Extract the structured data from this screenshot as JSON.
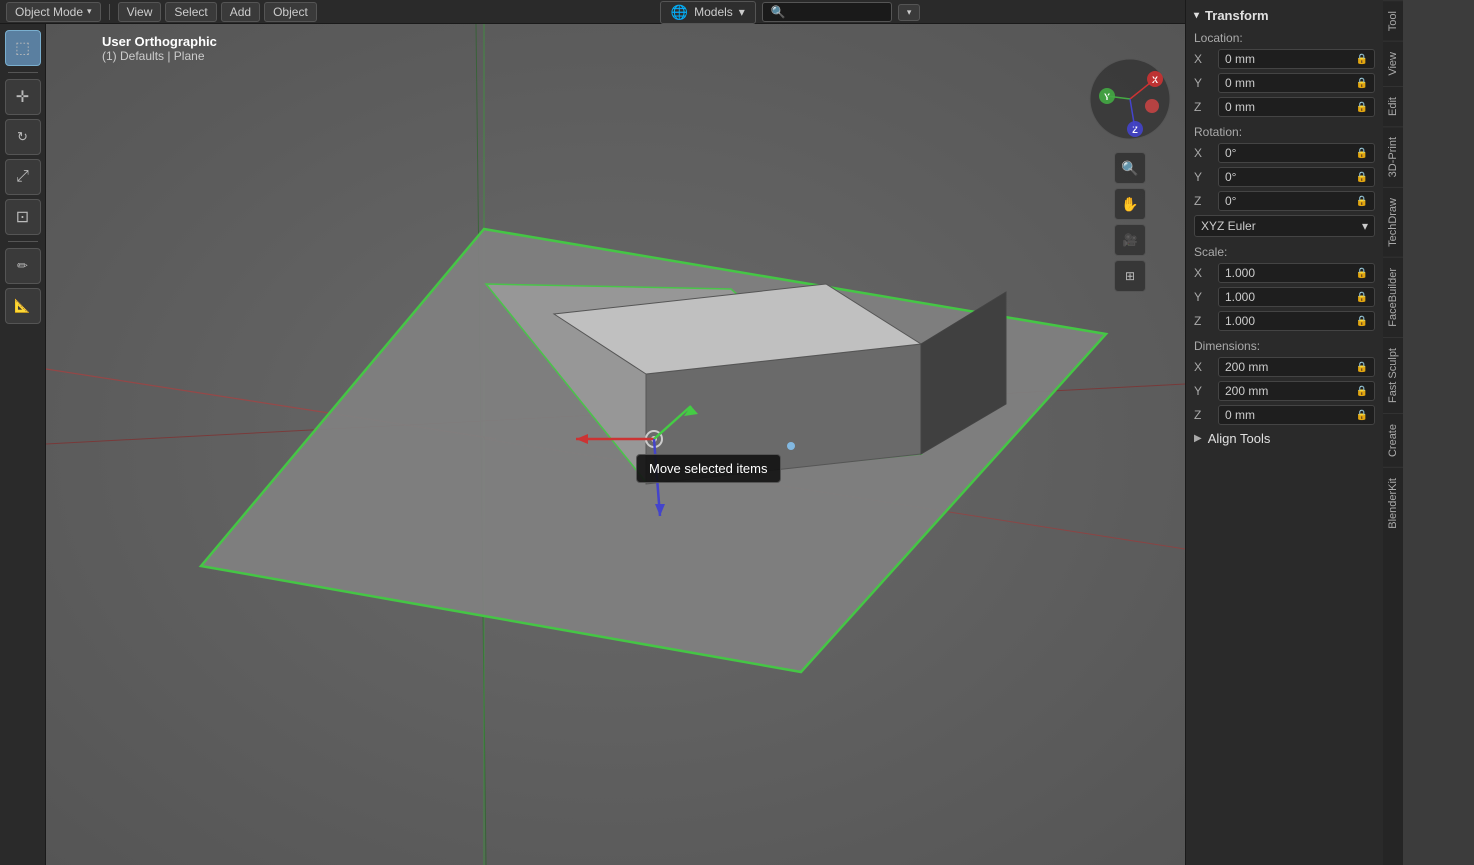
{
  "topbar": {
    "mode_label": "Object Mode",
    "view_label": "View",
    "select_label": "Select",
    "add_label": "Add",
    "object_label": "Object"
  },
  "header_center": {
    "models_label": "Models",
    "search_placeholder": "🔍"
  },
  "viewport": {
    "view_title": "User Orthographic",
    "view_subtitle": "(1) Defaults | Plane",
    "tooltip": "Move selected items"
  },
  "transform": {
    "title": "Transform",
    "location_label": "Location:",
    "location_x": "0 mm",
    "location_y": "0 mm",
    "location_z": "0 mm",
    "rotation_label": "Rotation:",
    "rotation_x": "0°",
    "rotation_y": "0°",
    "rotation_z": "0°",
    "euler_label": "XYZ Euler",
    "scale_label": "Scale:",
    "scale_x": "1.000",
    "scale_y": "1.000",
    "scale_z": "1.000",
    "dimensions_label": "Dimensions:",
    "dim_x": "200 mm",
    "dim_y": "200 mm",
    "dim_z": "0 mm"
  },
  "align_tools": {
    "label": "Align Tools"
  },
  "side_tabs": [
    "Tool",
    "View",
    "Edit",
    "3D-Print",
    "TechDraw",
    "FaceBuilder",
    "Fast Sculpt",
    "Create",
    "BlenderKit"
  ],
  "left_tools": [
    {
      "icon": "⬚",
      "name": "select-tool",
      "active": true
    },
    {
      "icon": "✛",
      "name": "move-tool",
      "active": false
    },
    {
      "icon": "↻",
      "name": "rotate-tool",
      "active": false
    },
    {
      "icon": "⤢",
      "name": "scale-tool",
      "active": false
    },
    {
      "icon": "⊡",
      "name": "transform-tool",
      "active": false
    }
  ]
}
